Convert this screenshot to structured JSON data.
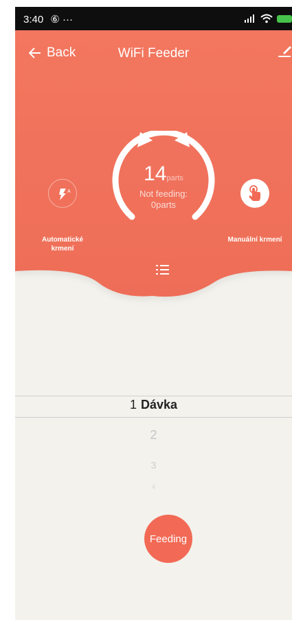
{
  "status_bar": {
    "time": "3:40",
    "extras": "⑥ ···"
  },
  "header": {
    "back_label": "Back",
    "title": "WiFi Feeder"
  },
  "feeder": {
    "count": "14",
    "unit": "parts",
    "status": "Not feeding: 0parts"
  },
  "buttons": {
    "auto_label": "Automatické krmení",
    "manual_label": "Manuální krmení",
    "feed_label": "Feeding"
  },
  "picker": {
    "selected_value": "1",
    "selected_label": "Dávka",
    "items": [
      "2",
      "3",
      "4"
    ]
  },
  "colors": {
    "accent": "#f26a55",
    "background": "#f3f2ed"
  },
  "icons": [
    "back-arrow-icon",
    "edit-icon",
    "auto-feed-icon",
    "hand-tap-icon",
    "list-icon",
    "wifi-icon",
    "signal-icon",
    "battery-icon"
  ]
}
